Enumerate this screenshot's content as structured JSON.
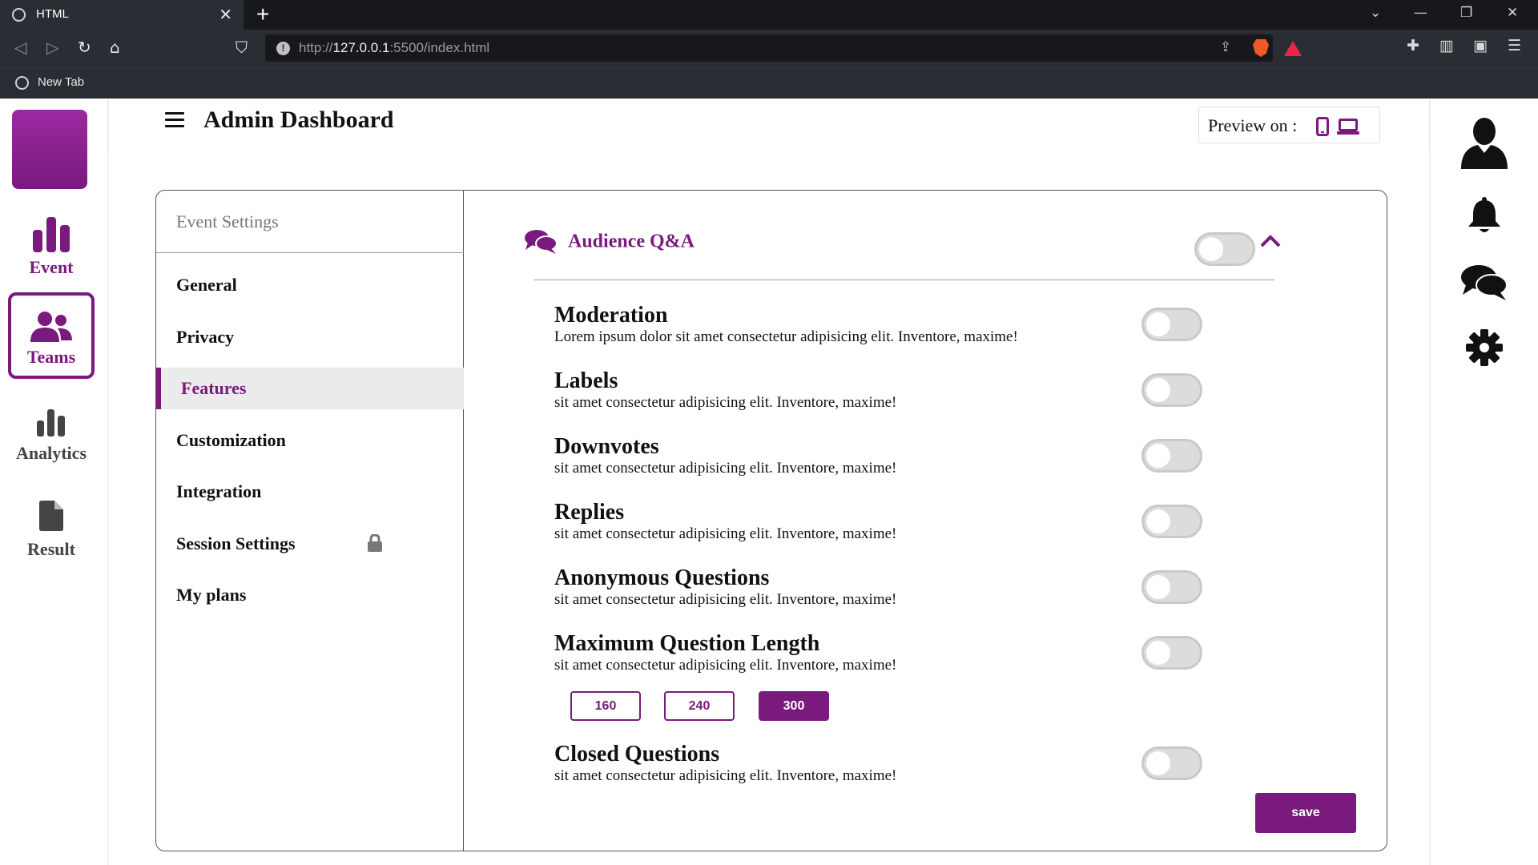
{
  "browser": {
    "tab_title": "HTML",
    "tab_close": "✕",
    "new_tab_symbol": "+",
    "url_host": "127.0.0.1",
    "url_prefix": "http://",
    "url_suffix": ":5500/index.html",
    "bookmark": "New Tab"
  },
  "app": {
    "title": "Admin Dashboard",
    "preview_label": "Preview on :",
    "accent_color": "#7a1a7e",
    "left_nav": [
      {
        "label": "Event",
        "icon": "bar-chart-icon"
      },
      {
        "label": "Teams",
        "icon": "users-icon",
        "active": true
      },
      {
        "label": "Analytics",
        "icon": "analytics-icon"
      },
      {
        "label": "Result",
        "icon": "file-icon"
      }
    ],
    "right_nav": [
      "user-icon",
      "bell-icon",
      "comments-icon",
      "gear-icon"
    ]
  },
  "settings_nav": {
    "heading": "Event Settings",
    "items": [
      {
        "label": "General"
      },
      {
        "label": "Privacy"
      },
      {
        "label": "Features",
        "active": true
      },
      {
        "label": "Customization"
      },
      {
        "label": "Integration"
      },
      {
        "label": "Session Settings",
        "locked": true
      },
      {
        "label": "My plans"
      }
    ]
  },
  "qa": {
    "title": "Audience Q&A",
    "enabled": false,
    "options": [
      {
        "name": "Moderation",
        "desc": "Lorem ipsum dolor sit amet consectetur adipisicing elit. Inventore, maxime!",
        "enabled": false
      },
      {
        "name": "Labels",
        "desc": "sit amet consectetur adipisicing elit. Inventore, maxime!",
        "enabled": false
      },
      {
        "name": "Downvotes",
        "desc": "sit amet consectetur adipisicing elit. Inventore, maxime!",
        "enabled": false
      },
      {
        "name": "Replies",
        "desc": "sit amet consectetur adipisicing elit. Inventore, maxime!",
        "enabled": false
      },
      {
        "name": "Anonymous Questions",
        "desc": "sit amet consectetur adipisicing elit. Inventore, maxime!",
        "enabled": false
      },
      {
        "name": "Maximum Question Length",
        "desc": "sit amet consectetur adipisicing elit. Inventore, maxime!",
        "enabled": false
      },
      {
        "name": "Closed Questions",
        "desc": "sit amet consectetur adipisicing elit. Inventore, maxime!",
        "enabled": false
      }
    ],
    "length_options": [
      "160",
      "240",
      "300"
    ],
    "length_selected": "300",
    "save_label": "save"
  }
}
